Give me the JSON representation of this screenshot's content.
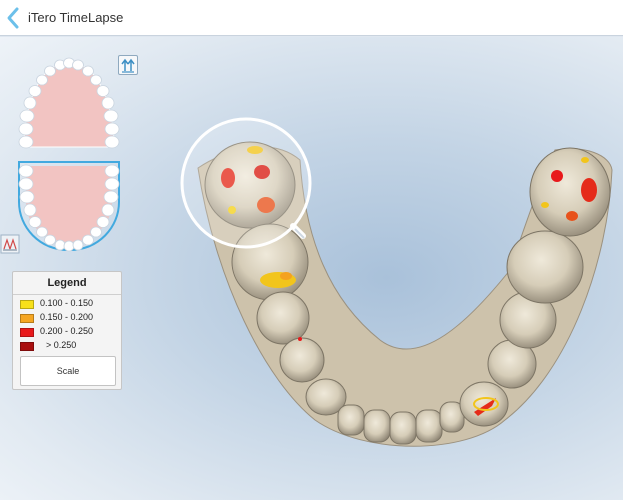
{
  "header": {
    "title": "iTero TimeLapse"
  },
  "icons": {
    "back": "chevron-left-icon",
    "swap": "swap-arrows-icon",
    "view": "jaw-view-icon",
    "magnifier": "magnifier-lens-icon"
  },
  "colors": {
    "accent": "#5fb8e6",
    "gum": "#f2c4c2",
    "tooth": "#d8d0bd",
    "background": "#c3d4e5"
  },
  "legend": {
    "title": "Legend",
    "items": [
      {
        "label": "0.100 - 0.150",
        "color": "#f7e01a"
      },
      {
        "label": "0.150 - 0.200",
        "color": "#f5a623"
      },
      {
        "label": "0.200 - 0.250",
        "color": "#e8191b"
      },
      {
        "label": "> 0.250",
        "color": "#a90f0f"
      }
    ],
    "scale_label": "Scale"
  }
}
